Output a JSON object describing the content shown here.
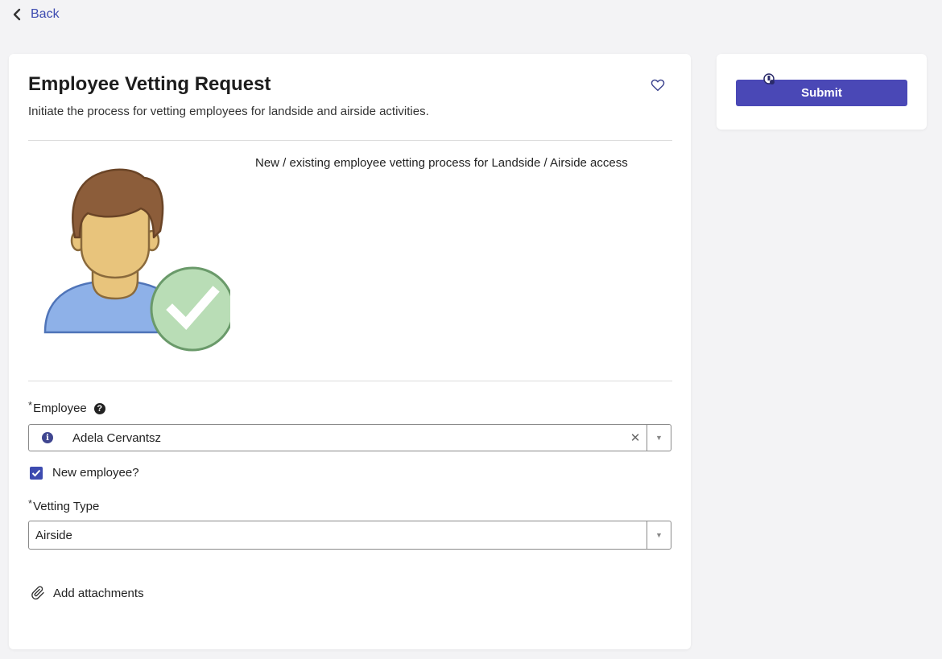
{
  "nav": {
    "back_label": "Back"
  },
  "form": {
    "title": "Employee Vetting Request",
    "subtitle": "Initiate the process for vetting employees for landside and airside activities.",
    "description": "New / existing employee vetting process for Landside / Airside access",
    "employee": {
      "label": "Employee",
      "required_mark": "*",
      "value": "Adela Cervantsz",
      "help_icon": "question-circle-icon",
      "info_icon": "info-circle-icon"
    },
    "new_employee": {
      "label": "New employee?",
      "checked": true
    },
    "vetting_type": {
      "label": "Vetting Type",
      "required_mark": "*",
      "value": "Airside"
    },
    "attachments_label": "Add attachments"
  },
  "actions": {
    "submit_label": "Submit"
  },
  "colors": {
    "accent": "#3d4bb0",
    "submit_bg": "#4a48b6",
    "background": "#f3f3f5"
  }
}
